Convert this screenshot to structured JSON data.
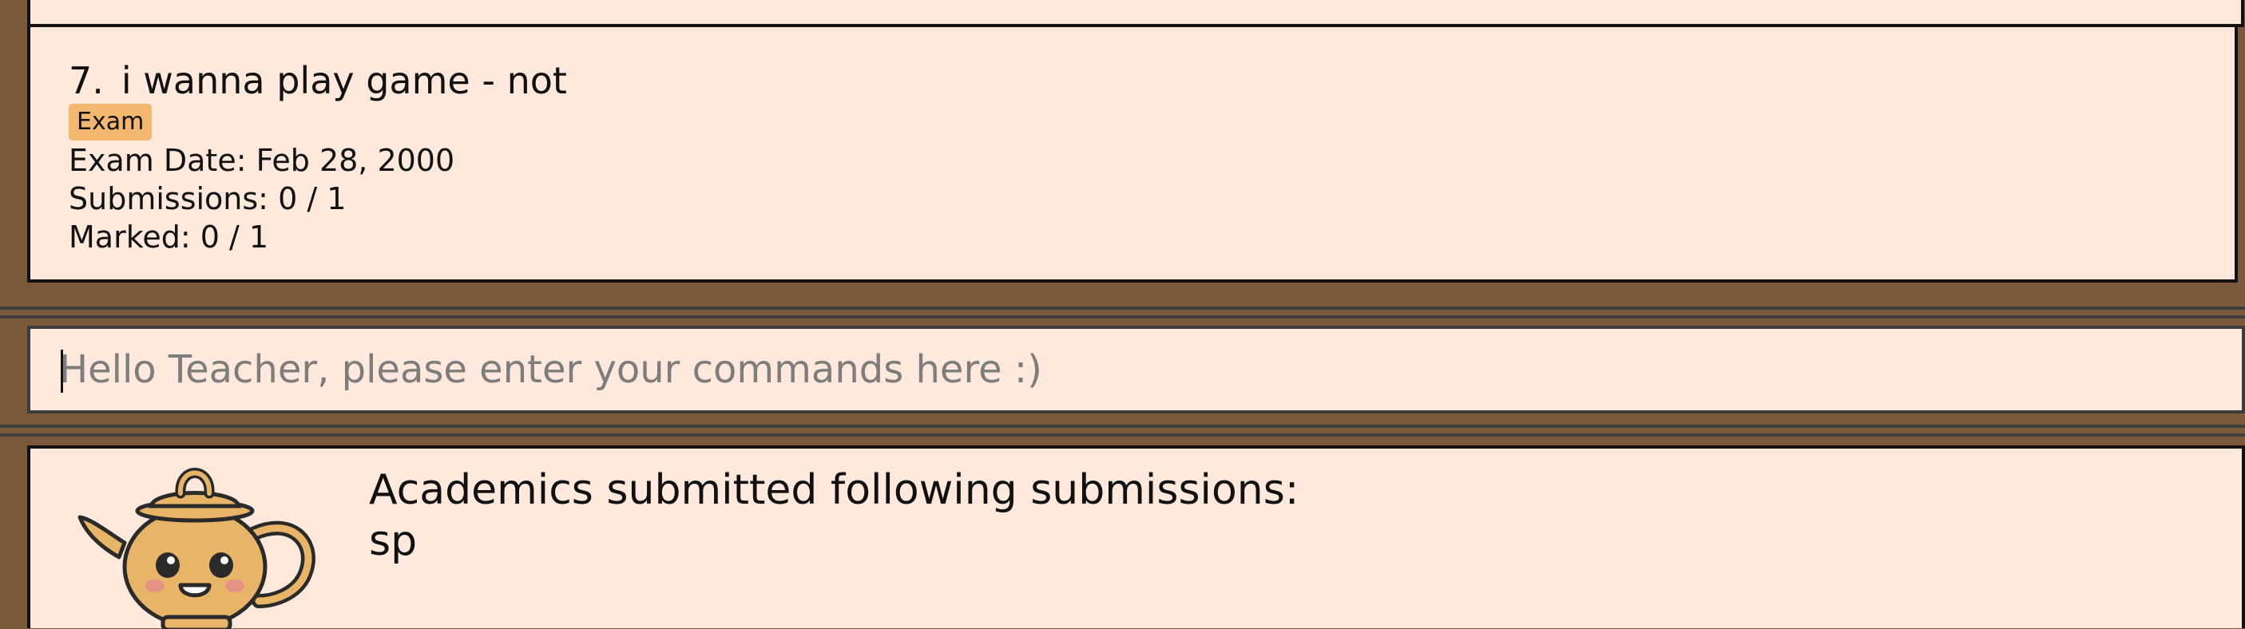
{
  "task_list": {
    "item": {
      "index": "7.",
      "title": "i wanna play game - not",
      "tag": "Exam",
      "exam_date": "Exam Date: Feb 28, 2000",
      "submissions": "Submissions: 0 / 1",
      "marked": "Marked: 0 / 1"
    }
  },
  "command_box": {
    "value": "",
    "placeholder": "Hello Teacher, please enter your commands here :)"
  },
  "result_display": {
    "line1": "Academics submitted following submissions:",
    "line2": "sp",
    "mascot_icon": "teapot-mascot-icon"
  },
  "colors": {
    "frame": "#7a5a3a",
    "panel": "#ffe8dc",
    "tag": "#f4b76f"
  }
}
